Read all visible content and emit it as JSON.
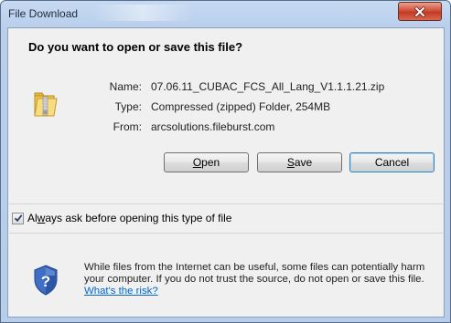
{
  "window": {
    "title": "File Download"
  },
  "dialog": {
    "prompt": "Do you want to open or save this file?",
    "file": {
      "name_label": "Name:",
      "name": "07.06.11_CUBAC_FCS_All_Lang_V1.1.1.21.zip",
      "type_label": "Type:",
      "type": "Compressed (zipped) Folder, 254MB",
      "from_label": "From:",
      "from": "arcsolutions.fileburst.com"
    },
    "buttons": {
      "open": {
        "mnemonic": "O",
        "rest": "pen"
      },
      "save": {
        "mnemonic": "S",
        "rest": "ave"
      },
      "cancel": "Cancel"
    },
    "always_ask": {
      "checked": true,
      "pre": "Al",
      "mnemonic": "w",
      "post": "ays ask before opening this type of file"
    },
    "warning": {
      "text": "While files from the Internet can be useful, some files can potentially harm your computer. If you do not trust the source, do not open or save this file. ",
      "link": "What's the risk?"
    }
  },
  "icons": [
    "close-icon",
    "zip-folder-icon",
    "check-icon",
    "security-shield-icon"
  ],
  "colors": {
    "title_bar": "#b9cfec",
    "close_button": "#c23a24",
    "dialog_background": "#f0f0f0",
    "link": "#0066cc",
    "default_button_border": "#3c7fb1"
  }
}
